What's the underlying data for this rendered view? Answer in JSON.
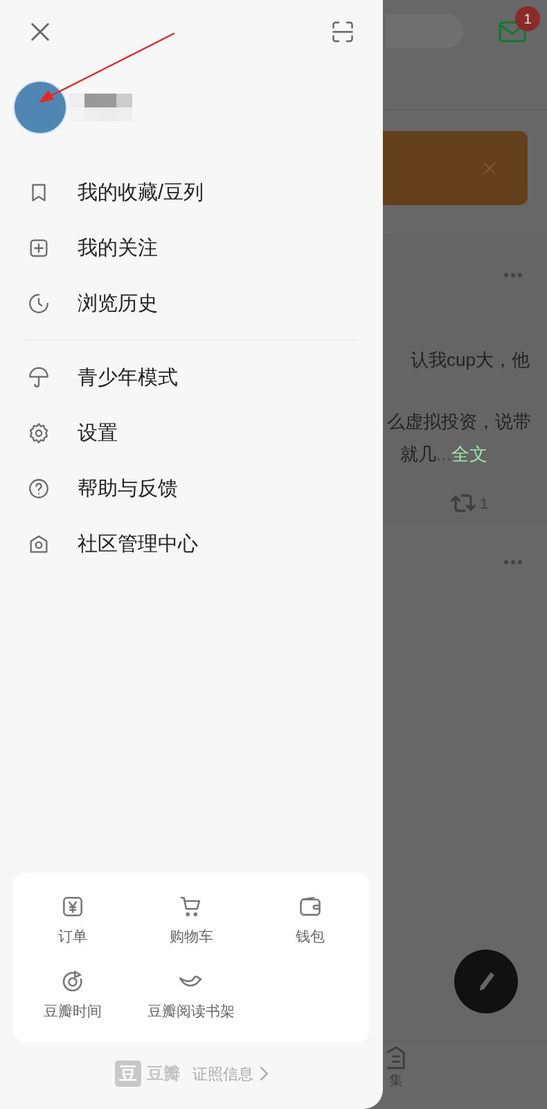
{
  "drawer": {
    "menu_groups": [
      [
        {
          "label": "我的收藏/豆列"
        },
        {
          "label": "我的关注"
        },
        {
          "label": "浏览历史"
        }
      ],
      [
        {
          "label": "青少年模式"
        },
        {
          "label": "设置"
        },
        {
          "label": "帮助与反馈"
        },
        {
          "label": "社区管理中心"
        }
      ]
    ],
    "services": [
      {
        "label": "订单"
      },
      {
        "label": "购物车"
      },
      {
        "label": "钱包"
      },
      {
        "label": "豆瓣时间"
      },
      {
        "label": "豆瓣阅读书架"
      }
    ],
    "footer": {
      "logo_mark": "豆",
      "logo_text": "豆瓣",
      "link": "证照信息"
    }
  },
  "background": {
    "mail_badge": "1",
    "post": {
      "lines": [
        "认我cup大，他",
        "么虚拟投资，说带"
      ],
      "last_line": "就几",
      "ellipsis": "...",
      "more_link": "全文",
      "repost_count": "1"
    },
    "bottom_nav": {
      "tab_label": "集"
    }
  }
}
